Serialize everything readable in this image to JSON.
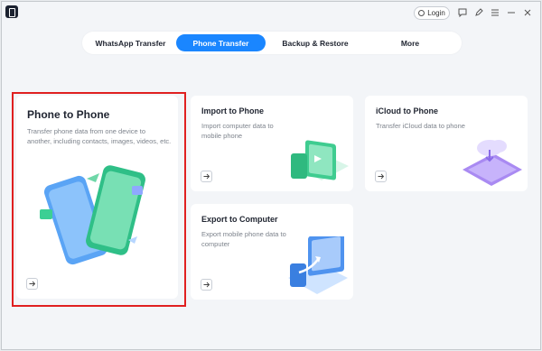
{
  "titlebar": {
    "login_label": "Login"
  },
  "tabs": [
    {
      "label": "WhatsApp Transfer",
      "active": false
    },
    {
      "label": "Phone Transfer",
      "active": true
    },
    {
      "label": "Backup & Restore",
      "active": false
    },
    {
      "label": "More",
      "active": false
    }
  ],
  "cards": {
    "phone_to_phone": {
      "title": "Phone to Phone",
      "desc": "Transfer phone data from one device to another, including contacts, images, videos, etc."
    },
    "import_to_phone": {
      "title": "Import to Phone",
      "desc": "Import computer data to mobile phone"
    },
    "icloud_to_phone": {
      "title": "iCloud to Phone",
      "desc": "Transfer iCloud data to phone"
    },
    "export_to_computer": {
      "title": "Export to Computer",
      "desc": "Export mobile phone data to computer"
    }
  },
  "colors": {
    "accent": "#1a86ff",
    "selection": "#e02020"
  }
}
